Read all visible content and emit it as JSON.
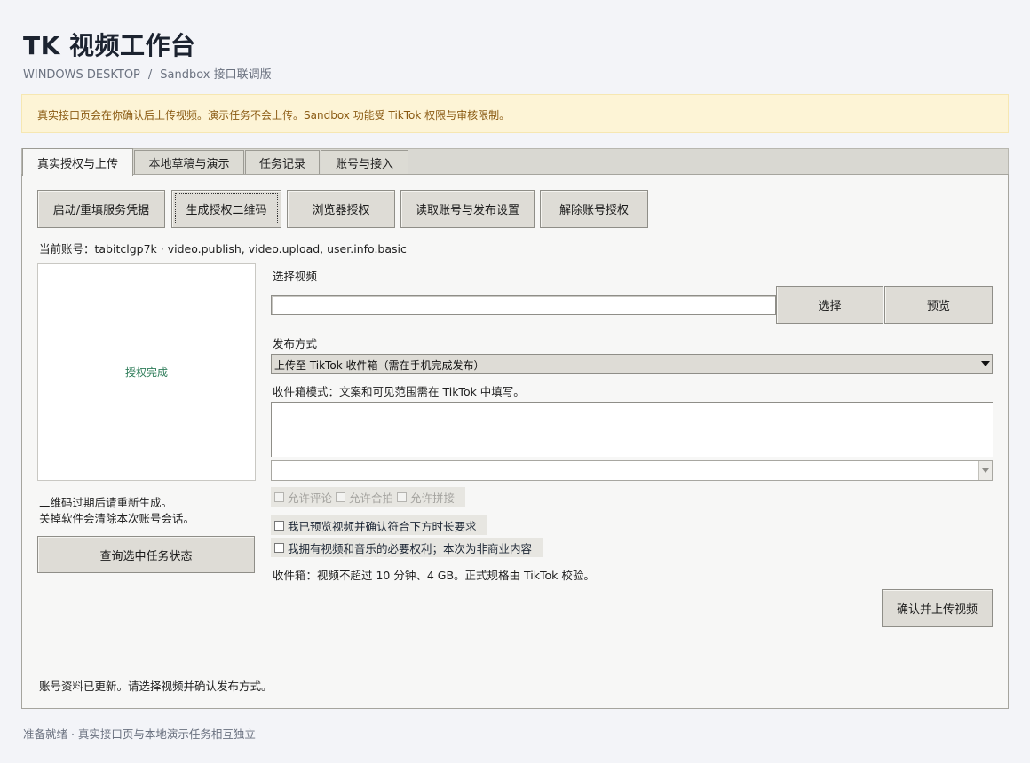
{
  "app": {
    "title": "TK 视频工作台",
    "breadcrumb_platform": "WINDOWS DESKTOP",
    "breadcrumb_sep": "/",
    "breadcrumb_mode": "Sandbox 接口联调版"
  },
  "notice": "真实接口页会在你确认后上传视频。演示任务不会上传。Sandbox 功能受 TikTok 权限与审核限制。",
  "tabs": [
    {
      "label": "真实授权与上传",
      "active": true
    },
    {
      "label": "本地草稿与演示",
      "active": false
    },
    {
      "label": "任务记录",
      "active": false
    },
    {
      "label": "账号与接入",
      "active": false
    }
  ],
  "toolbar": {
    "start_label": "启动/重填服务凭据",
    "qr_label": "生成授权二维码",
    "browser_label": "浏览器授权",
    "read_label": "读取账号与发布设置",
    "revoke_label": "解除账号授权"
  },
  "account_line": "当前账号：tabitclgp7k · video.publish, video.upload, user.info.basic",
  "qr": {
    "status": "授权完成",
    "hint1": "二维码过期后请重新生成。",
    "hint2": "关掉软件会清除本次账号会话。",
    "query_label": "查询选中任务状态"
  },
  "video": {
    "section_label": "选择视频",
    "path_value": "",
    "select_label": "选择",
    "preview_label": "预览"
  },
  "publish": {
    "section_label": "发布方式",
    "mode_value": "上传至 TikTok 收件箱（需在手机完成发布）",
    "mode_hint": "收件箱模式：文案和可见范围需在 TikTok 中填写。",
    "privacy_value": ""
  },
  "options": {
    "allow_comment": "允许评论",
    "allow_duet": "允许合拍",
    "allow_stitch": "允许拼接"
  },
  "confirm": {
    "previewed": "我已预览视频并确认符合下方时长要求",
    "rights": "我拥有视频和音乐的必要权利；本次为非商业内容"
  },
  "limits_note": "收件箱：视频不超过 10 分钟、4 GB。正式规格由 TikTok 校验。",
  "upload_label": "确认并上传视频",
  "panel_status": "账号资料已更新。请选择视频并确认发布方式。",
  "footer_status": "准备就绪 · 真实接口页与本地演示任务相互独立"
}
